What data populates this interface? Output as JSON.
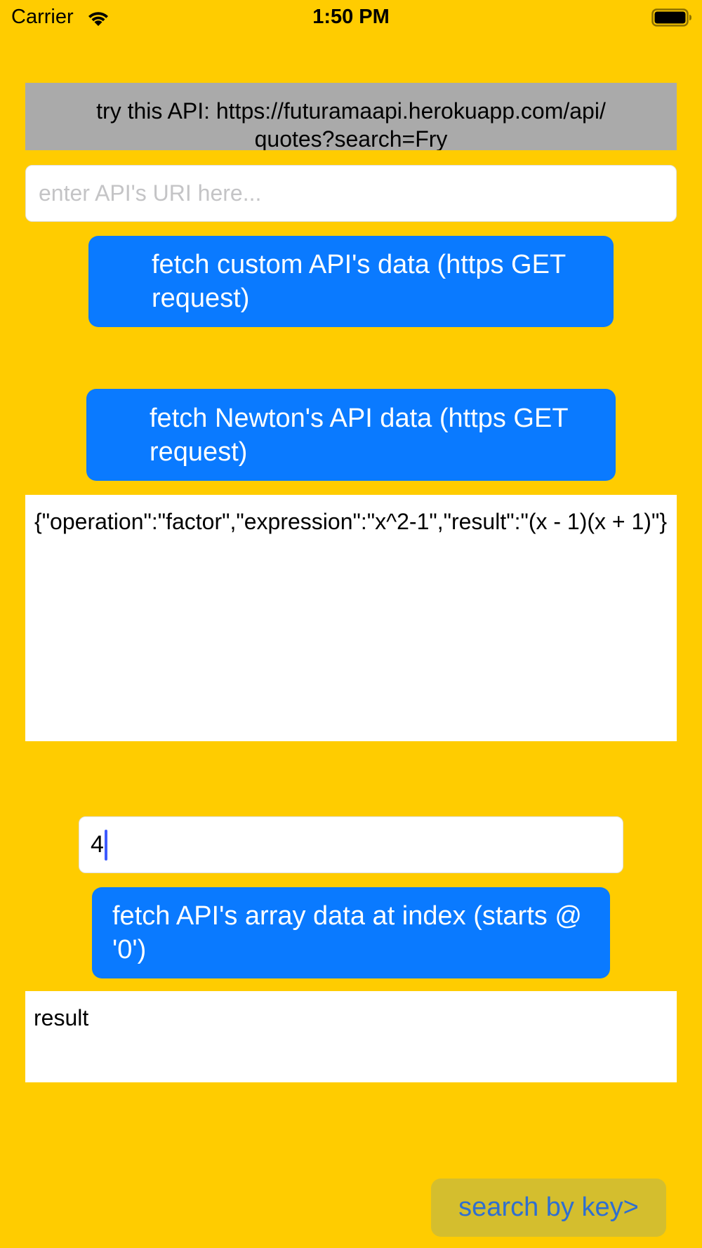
{
  "status_bar": {
    "carrier": "Carrier",
    "time": "1:50 PM",
    "wifi_icon": "wifi-icon",
    "battery_icon": "battery-icon"
  },
  "hint": {
    "text": "try this API:  https://futuramaapi.herokuapp.com/api/\nquotes?search=Fry"
  },
  "uri_input": {
    "value": "",
    "placeholder": "enter API's URI here..."
  },
  "buttons": {
    "fetch_custom": "fetch custom API's data (https GET request)",
    "fetch_newton": "fetch Newton's API data (https GET request)",
    "fetch_index": "fetch API's array data at index (starts @ '0')",
    "search_by_key": "search by key>"
  },
  "response_text": "{\"operation\":\"factor\",\"expression\":\"x^2-1\",\"result\":\"(x - 1)(x + 1)\"}",
  "index_input": {
    "value": "4"
  },
  "result_label": "result",
  "colors": {
    "background": "#FFCC00",
    "button_blue": "#0A7AFF",
    "banner_gray": "#AAAAAA",
    "search_button_bg": "#D4BE2E",
    "search_button_text": "#2F6FD0"
  }
}
